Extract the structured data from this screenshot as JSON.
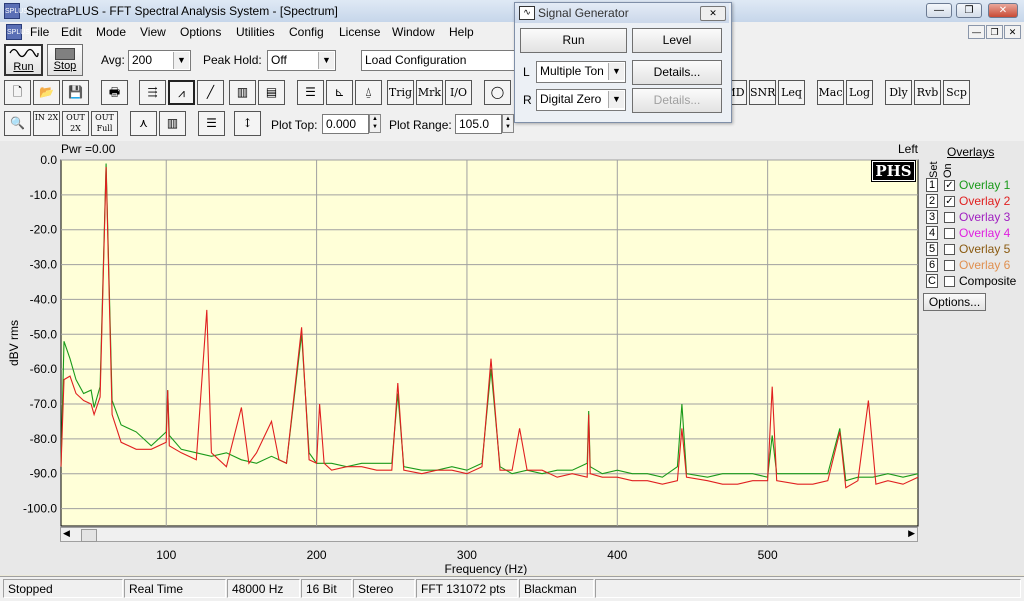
{
  "window": {
    "title": "SpectraPLUS - FFT Spectral Analysis System - [Spectrum]",
    "app_icon_label": "SPLUS",
    "min_glyph": "—",
    "max_glyph": "❐",
    "close_glyph": "✕"
  },
  "menu": [
    "File",
    "Edit",
    "Mode",
    "View",
    "Options",
    "Utilities",
    "Config",
    "License",
    "Window",
    "Help"
  ],
  "toolbar": {
    "run_label": "Run",
    "stop_label": "Stop",
    "avg_label": "Avg:",
    "avg_value": "200",
    "peak_hold_label": "Peak Hold:",
    "peak_hold_value": "Off",
    "config_value": "Load Configuration",
    "row2_left": [
      "",
      "",
      "",
      "",
      "",
      "",
      "",
      "",
      "",
      "",
      ""
    ],
    "text_buttons": [
      "Trig",
      "Mrk",
      "I/O"
    ],
    "right_buttons": [
      "MD",
      "SNR",
      "Leq",
      "Mac",
      "Log",
      "Dly",
      "Rvb",
      "Scp"
    ],
    "zoom_buttons": [
      "IN 2X",
      "OUT 2X",
      "OUT Full"
    ],
    "plot_top_label": "Plot Top:",
    "plot_top_value": "0.000",
    "plot_range_label": "Plot Range:",
    "plot_range_value": "105.0"
  },
  "signal_generator": {
    "title": "Signal Generator",
    "run_label": "Run",
    "level_label": "Level",
    "left_channel": "L",
    "left_value": "Multiple Ton",
    "left_details": "Details...",
    "right_channel": "R",
    "right_value": "Digital Zero",
    "right_details": "Details..."
  },
  "plot": {
    "power_readout": "Pwr =0.00",
    "channel_label": "Left",
    "logo": "PHS",
    "bg_color": "#ffffd8"
  },
  "overlays": {
    "header_set": "Set",
    "header_on": "On",
    "title": "Overlays",
    "items": [
      {
        "num": "1",
        "label": "Overlay 1",
        "checked": true,
        "color": "#1a9a1a"
      },
      {
        "num": "2",
        "label": "Overlay 2",
        "checked": true,
        "color": "#e02020"
      },
      {
        "num": "3",
        "label": "Overlay 3",
        "checked": false,
        "color": "#a020c0"
      },
      {
        "num": "4",
        "label": "Overlay 4",
        "checked": false,
        "color": "#e020e0"
      },
      {
        "num": "5",
        "label": "Overlay 5",
        "checked": false,
        "color": "#8a5a10"
      },
      {
        "num": "6",
        "label": "Overlay 6",
        "checked": false,
        "color": "#e09050"
      },
      {
        "num": "C",
        "label": "Composite",
        "checked": false,
        "color": "#000000"
      }
    ],
    "options_label": "Options..."
  },
  "status": [
    "Stopped",
    "Real Time",
    "48000 Hz",
    "16 Bit",
    "Stereo",
    "FFT 131072 pts",
    "Blackman"
  ],
  "chart_data": {
    "type": "line",
    "xlabel": "Frequency (Hz)",
    "ylabel": "dBV rms",
    "xlim": [
      30,
      600
    ],
    "ylim": [
      -105,
      0
    ],
    "x_ticks": [
      100,
      200,
      300,
      400,
      500
    ],
    "y_ticks": [
      0,
      -10,
      -20,
      -30,
      -40,
      -50,
      -60,
      -70,
      -80,
      -90,
      -100
    ],
    "y_tick_labels": [
      "0.0",
      "-10.0",
      "-20.0",
      "-30.0",
      "-40.0",
      "-50.0",
      "-60.0",
      "-70.0",
      "-80.0",
      "-90.0",
      "-100.0"
    ],
    "grid": true,
    "series": [
      {
        "name": "Overlay 1",
        "color": "#1a9a1a",
        "points": [
          [
            30,
            -88
          ],
          [
            32,
            -52
          ],
          [
            36,
            -57
          ],
          [
            40,
            -63
          ],
          [
            45,
            -67
          ],
          [
            50,
            -66
          ],
          [
            52,
            -71
          ],
          [
            56,
            -65
          ],
          [
            60,
            -1
          ],
          [
            64,
            -69
          ],
          [
            70,
            -76
          ],
          [
            80,
            -78
          ],
          [
            90,
            -82
          ],
          [
            100,
            -78
          ],
          [
            101,
            -66
          ],
          [
            102,
            -79
          ],
          [
            110,
            -83
          ],
          [
            120,
            -84
          ],
          [
            130,
            -85
          ],
          [
            140,
            -84
          ],
          [
            150,
            -86
          ],
          [
            160,
            -87
          ],
          [
            170,
            -85
          ],
          [
            180,
            -87
          ],
          [
            190,
            -50
          ],
          [
            195,
            -84
          ],
          [
            200,
            -87
          ],
          [
            210,
            -87
          ],
          [
            220,
            -88
          ],
          [
            230,
            -87
          ],
          [
            240,
            -87
          ],
          [
            250,
            -87
          ],
          [
            254,
            -67
          ],
          [
            258,
            -88
          ],
          [
            270,
            -89
          ],
          [
            280,
            -89
          ],
          [
            290,
            -88
          ],
          [
            300,
            -89
          ],
          [
            310,
            -87
          ],
          [
            316,
            -60
          ],
          [
            322,
            -88
          ],
          [
            330,
            -90
          ],
          [
            340,
            -89
          ],
          [
            350,
            -90
          ],
          [
            360,
            -89
          ],
          [
            370,
            -89
          ],
          [
            380,
            -87
          ],
          [
            381,
            -72
          ],
          [
            382,
            -88
          ],
          [
            390,
            -90
          ],
          [
            400,
            -89
          ],
          [
            410,
            -90
          ],
          [
            420,
            -90
          ],
          [
            430,
            -91
          ],
          [
            440,
            -88
          ],
          [
            443,
            -70
          ],
          [
            446,
            -90
          ],
          [
            460,
            -91
          ],
          [
            470,
            -90
          ],
          [
            480,
            -90
          ],
          [
            490,
            -90
          ],
          [
            500,
            -91
          ],
          [
            503,
            -79
          ],
          [
            506,
            -90
          ],
          [
            520,
            -90
          ],
          [
            530,
            -90
          ],
          [
            540,
            -90
          ],
          [
            548,
            -77
          ],
          [
            552,
            -92
          ],
          [
            560,
            -91
          ],
          [
            570,
            -91
          ],
          [
            580,
            -90
          ],
          [
            590,
            -91
          ],
          [
            600,
            -90
          ]
        ]
      },
      {
        "name": "Overlay 2",
        "color": "#e02020",
        "points": [
          [
            30,
            -88
          ],
          [
            32,
            -63
          ],
          [
            36,
            -62
          ],
          [
            40,
            -67
          ],
          [
            45,
            -69
          ],
          [
            50,
            -70
          ],
          [
            52,
            -73
          ],
          [
            56,
            -68
          ],
          [
            60,
            -2
          ],
          [
            64,
            -73
          ],
          [
            70,
            -81
          ],
          [
            80,
            -83
          ],
          [
            90,
            -83
          ],
          [
            100,
            -81
          ],
          [
            101,
            -66
          ],
          [
            102,
            -82
          ],
          [
            110,
            -84
          ],
          [
            120,
            -86
          ],
          [
            127,
            -43
          ],
          [
            130,
            -84
          ],
          [
            140,
            -88
          ],
          [
            150,
            -71
          ],
          [
            155,
            -87
          ],
          [
            160,
            -84
          ],
          [
            170,
            -75
          ],
          [
            175,
            -86
          ],
          [
            180,
            -87
          ],
          [
            190,
            -48
          ],
          [
            195,
            -86
          ],
          [
            200,
            -87
          ],
          [
            202,
            -70
          ],
          [
            205,
            -87
          ],
          [
            210,
            -89
          ],
          [
            220,
            -88
          ],
          [
            230,
            -88
          ],
          [
            240,
            -89
          ],
          [
            250,
            -89
          ],
          [
            254,
            -64
          ],
          [
            258,
            -89
          ],
          [
            270,
            -90
          ],
          [
            280,
            -89
          ],
          [
            290,
            -89
          ],
          [
            300,
            -90
          ],
          [
            310,
            -88
          ],
          [
            316,
            -57
          ],
          [
            322,
            -89
          ],
          [
            330,
            -89
          ],
          [
            335,
            -77
          ],
          [
            340,
            -89
          ],
          [
            350,
            -89
          ],
          [
            360,
            -91
          ],
          [
            370,
            -90
          ],
          [
            380,
            -91
          ],
          [
            381,
            -73
          ],
          [
            382,
            -90
          ],
          [
            390,
            -91
          ],
          [
            400,
            -91
          ],
          [
            410,
            -92
          ],
          [
            420,
            -92
          ],
          [
            430,
            -93
          ],
          [
            440,
            -92
          ],
          [
            443,
            -77
          ],
          [
            446,
            -91
          ],
          [
            460,
            -92
          ],
          [
            470,
            -93
          ],
          [
            480,
            -93
          ],
          [
            490,
            -92
          ],
          [
            500,
            -92
          ],
          [
            503,
            -65
          ],
          [
            506,
            -92
          ],
          [
            520,
            -93
          ],
          [
            530,
            -93
          ],
          [
            540,
            -92
          ],
          [
            548,
            -78
          ],
          [
            552,
            -94
          ],
          [
            560,
            -92
          ],
          [
            567,
            -69
          ],
          [
            572,
            -93
          ],
          [
            580,
            -92
          ],
          [
            590,
            -93
          ],
          [
            600,
            -91
          ]
        ]
      }
    ]
  }
}
